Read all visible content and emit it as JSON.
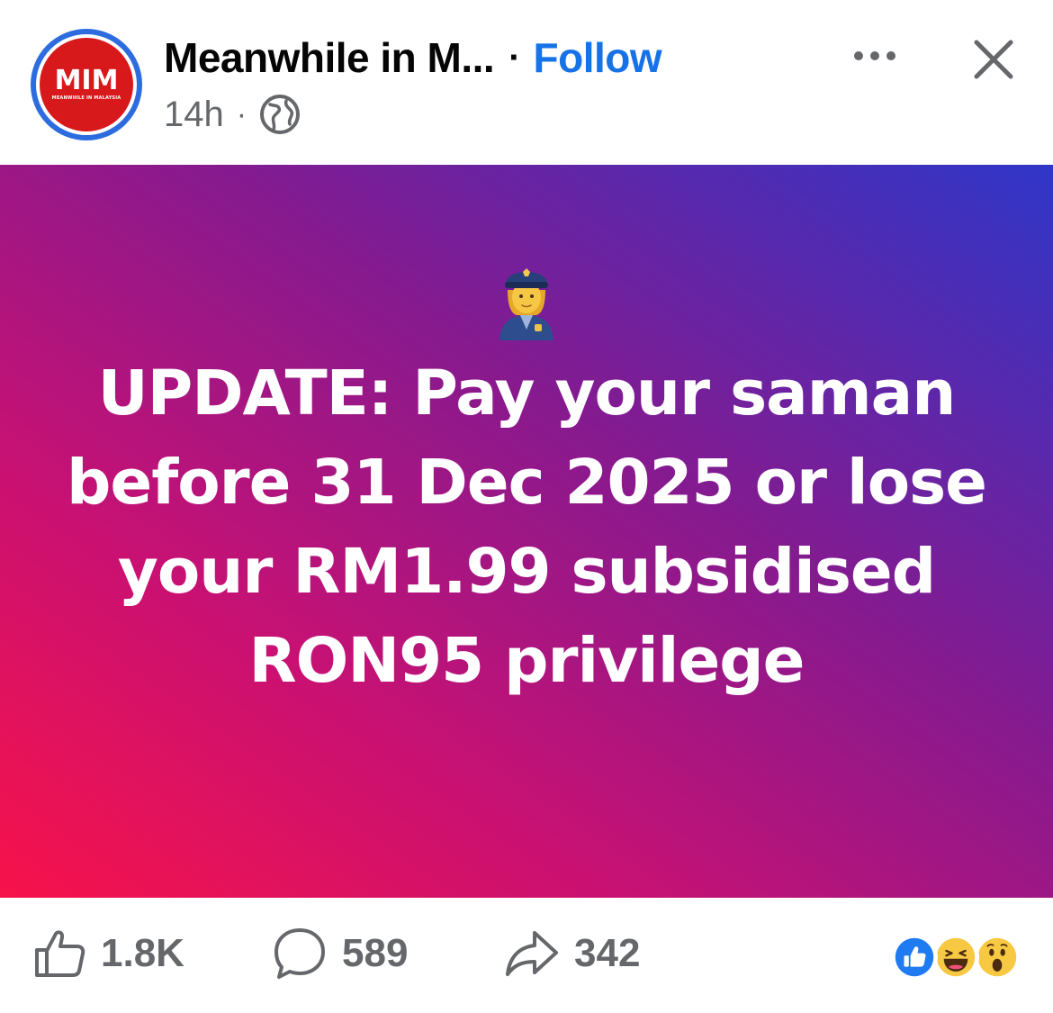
{
  "header": {
    "avatar_text": "MIM",
    "avatar_subtext": "MEANWHILE IN MALAYSIA",
    "page_name": "Meanwhile in M...",
    "separator": "·",
    "follow_label": "Follow",
    "time": "14h",
    "meta_separator": "·",
    "privacy_icon": "globe-icon",
    "more_icon": "more-horizontal-icon",
    "close_icon": "close-icon"
  },
  "post": {
    "emoji_icon": "police-officer-emoji",
    "text": "UPDATE: Pay your saman before 31 Dec 2025 or lose your RM1.99 subsidised RON95 privilege",
    "background_colors": [
      "#f7124a",
      "#c81173",
      "#861a8f",
      "#2f36c8"
    ]
  },
  "footer": {
    "like_icon": "thumbs-up-icon",
    "like_count": "1.8K",
    "comment_icon": "comment-bubble-icon",
    "comment_count": "589",
    "share_icon": "share-arrow-icon",
    "share_count": "342",
    "reactions": [
      "like-reaction-icon",
      "haha-reaction-icon",
      "wow-reaction-icon"
    ]
  },
  "colors": {
    "follow": "#1672e6",
    "muted_text": "#65676b",
    "avatar_ring": "#2d6cdf",
    "avatar_fill": "#d8191c"
  }
}
